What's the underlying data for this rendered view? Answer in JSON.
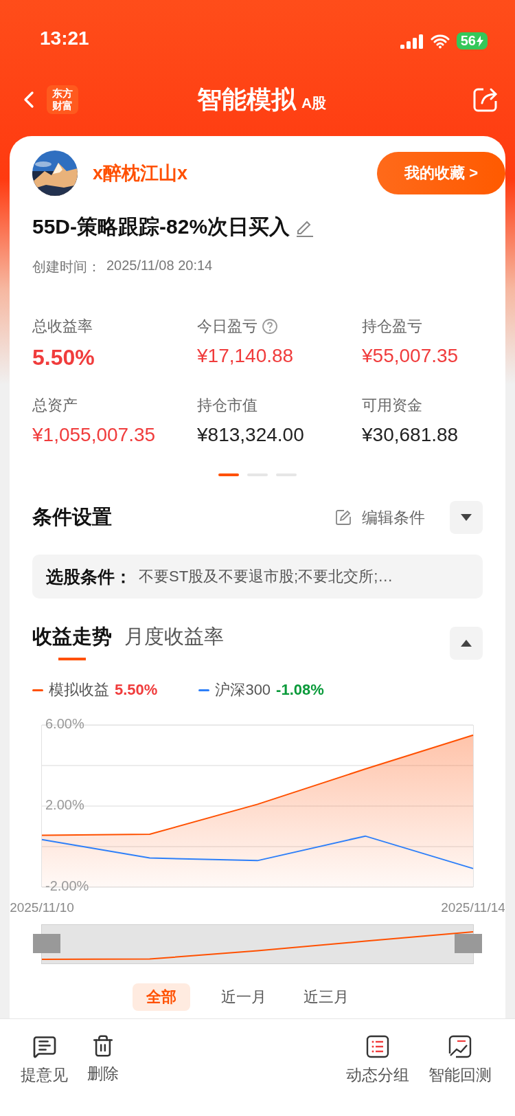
{
  "status_bar": {
    "time": "13:21",
    "battery": "56"
  },
  "header": {
    "logo": "东方财富",
    "title": "智能模拟",
    "badge": "A股"
  },
  "profile": {
    "username": "x醉枕江山x",
    "favorites_button": "我的收藏 >"
  },
  "strategy": {
    "title": "55D-策略跟踪-82%次日买入",
    "created_label": "创建时间：",
    "created_value": "2025/11/08 20:14"
  },
  "stats": [
    {
      "label": "总收益率",
      "value": "5.50%",
      "kind": "percent",
      "highlight": true,
      "has_help": false
    },
    {
      "label": "今日盈亏",
      "value": "¥17,140.88",
      "kind": "money",
      "highlight": true,
      "has_help": true
    },
    {
      "label": "持仓盈亏",
      "value": "¥55,007.35",
      "kind": "money",
      "highlight": true,
      "has_help": false
    },
    {
      "label": "总资产",
      "value": "¥1,055,007.35",
      "kind": "money",
      "highlight": true,
      "has_help": false
    },
    {
      "label": "持仓市值",
      "value": "¥813,324.00",
      "kind": "money",
      "highlight": false,
      "has_help": false
    },
    {
      "label": "可用资金",
      "value": "¥30,681.88",
      "kind": "money",
      "highlight": false,
      "has_help": false
    }
  ],
  "pager": [
    {
      "selected": true
    },
    {
      "selected": false
    },
    {
      "selected": false
    }
  ],
  "conditions": {
    "title": "条件设置",
    "edit_label": "编辑条件",
    "expanded": false,
    "filter_label": "选股条件：",
    "filter_text": "不要ST股及不要退市股;不要北交所;…"
  },
  "returns": {
    "tabs": [
      {
        "label": "收益走势",
        "selected": true
      },
      {
        "label": "月度收益率",
        "selected": false
      }
    ],
    "expanded": true,
    "legend": [
      {
        "value": "5.50%",
        "color": "#f03c3c"
      },
      {
        "value": "-1.08%",
        "color": "#0a9a3a"
      }
    ],
    "chart_data": {
      "type": "line",
      "categories": [
        "2025/11/10",
        null,
        null,
        null,
        "2025/11/14"
      ],
      "series": [
        {
          "name": "模拟收益",
          "color": "#ff5000",
          "values": [
            0.56,
            0.61,
            2.09,
            3.83,
            5.5
          ]
        },
        {
          "name": "沪深300",
          "color": "#2d7ff9",
          "values": [
            0.35,
            -0.56,
            -0.69,
            0.52,
            -1.08
          ]
        }
      ],
      "ylim": [
        -2,
        6
      ],
      "yticks": [
        {
          "value": 6,
          "label": "6.00%"
        },
        {
          "value": 2,
          "label": "2.00%"
        },
        {
          "value": -2,
          "label": "-2.00%"
        }
      ]
    },
    "range_slider": {
      "level": 1
    },
    "periods": [
      {
        "label": "全部",
        "selected": true
      },
      {
        "label": "近一月",
        "selected": false
      },
      {
        "label": "近三月",
        "selected": false
      }
    ]
  },
  "toolbar": {
    "left": [
      {
        "label": "提意见",
        "kind": "feedback"
      },
      {
        "label": "删除",
        "kind": "delete"
      }
    ],
    "right": [
      {
        "label": "动态分组",
        "kind": "group"
      },
      {
        "label": "智能回测",
        "kind": "backtest"
      }
    ]
  }
}
